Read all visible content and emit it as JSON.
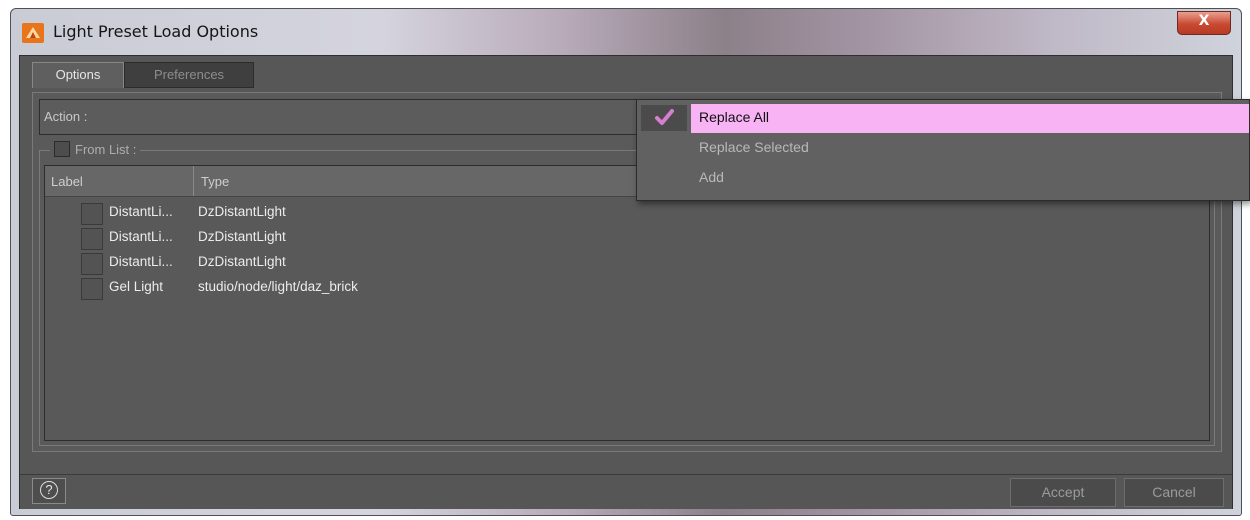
{
  "window": {
    "title": "Light Preset Load Options",
    "close_label": "X"
  },
  "tabs": [
    {
      "label": "Options",
      "active": true
    },
    {
      "label": "Preferences",
      "active": false
    }
  ],
  "action": {
    "label": "Action :",
    "menu": [
      {
        "label": "Replace All",
        "selected": true
      },
      {
        "label": "Replace Selected",
        "selected": false
      },
      {
        "label": "Add",
        "selected": false
      }
    ]
  },
  "from_list": {
    "label": "From List :",
    "checked": false,
    "columns": [
      "Label",
      "Type"
    ],
    "rows": [
      {
        "label": "DistantLi...",
        "type": "DzDistantLight"
      },
      {
        "label": "DistantLi...",
        "type": "DzDistantLight"
      },
      {
        "label": "DistantLi...",
        "type": "DzDistantLight"
      },
      {
        "label": "Gel Light",
        "type": "studio/node/light/daz_brick"
      }
    ]
  },
  "footer": {
    "help_label": "?",
    "accept_label": "Accept",
    "cancel_label": "Cancel"
  },
  "colors": {
    "highlight": "#f8b3f4",
    "checkmark": "#d67fd0",
    "dialog_bg": "#575757"
  }
}
